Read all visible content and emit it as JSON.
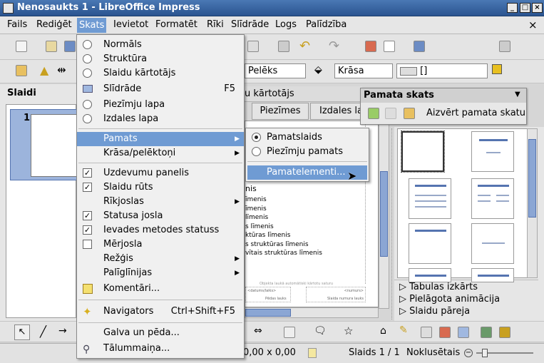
{
  "window": {
    "title": "Nenosaukts 1 - LibreOffice Impress",
    "controls": [
      "_",
      "□",
      "×"
    ],
    "doc_close": "×"
  },
  "menubar": [
    "Fails",
    "Rediģēt",
    "Skats",
    "Ievietot",
    "Formatēt",
    "Rīki",
    "Slīdrāde",
    "Logs",
    "Palīdzība"
  ],
  "formatbar": {
    "color_combo": "Pelēks",
    "fill_type": "Krāsa",
    "fill_value": "[]"
  },
  "slides_panel": {
    "title": "Slaidi",
    "slide_number": "1"
  },
  "tabs": {
    "partial_title": "u kārtotājs",
    "tab_notes": "Piezīmes",
    "tab_handouts": "Izdales la"
  },
  "view_menu": {
    "items": [
      {
        "label": "Normāls",
        "type": "radio",
        "checked": false
      },
      {
        "label": "Struktūra",
        "type": "radio",
        "checked": false
      },
      {
        "label": "Slaidu kārtotājs",
        "type": "radio",
        "checked": false
      },
      {
        "label": "Slīdrāde",
        "type": "icon",
        "shortcut": "F5"
      },
      {
        "label": "Piezīmju lapa",
        "type": "radio",
        "checked": false
      },
      {
        "label": "Izdales lapa",
        "type": "radio",
        "checked": false
      },
      {
        "label": "Pamats",
        "type": "submenu",
        "highlighted": true
      },
      {
        "label": "Krāsa/pelēktoņi",
        "type": "submenu"
      },
      {
        "label": "Uzdevumu panelis",
        "type": "check",
        "checked": true
      },
      {
        "label": "Slaidu rūts",
        "type": "check",
        "checked": true
      },
      {
        "label": "Rīkjoslas",
        "type": "submenu"
      },
      {
        "label": "Statusa josla",
        "type": "check",
        "checked": true
      },
      {
        "label": "Ievades metodes statuss",
        "type": "check",
        "checked": true
      },
      {
        "label": "Mērjosla",
        "type": "check",
        "checked": false
      },
      {
        "label": "Režģis",
        "type": "submenu"
      },
      {
        "label": "Palīglīnijas",
        "type": "submenu"
      },
      {
        "label": "Komentāri...",
        "type": "icon"
      },
      {
        "label": "Navigators",
        "type": "icon",
        "shortcut": "Ctrl+Shift+F5"
      },
      {
        "label": "Galva un pēda...",
        "type": "plain"
      },
      {
        "label": "Tālummaiņa...",
        "type": "icon"
      }
    ]
  },
  "master_submenu": {
    "items": [
      {
        "label": "Pamatslaids",
        "type": "radio",
        "checked": true
      },
      {
        "label": "Piezīmju pamats",
        "type": "radio",
        "checked": false
      },
      {
        "label": "Pamatelementi...",
        "type": "plain",
        "highlighted": true
      }
    ]
  },
  "slide_content": {
    "lines": [
      "nis",
      "īmenis",
      "īmenis",
      "līmenis",
      "s līmenis",
      "ktūras līmenis",
      "s struktūras līmenis",
      "vītais struktūras līmenis"
    ],
    "footer_left": "Objekta laukā automātiski kārtotu saturu",
    "footer_boxes": [
      "<datums/laiks>",
      "Pēdas lauks",
      "Slaida numura lauks",
      "<numurs>"
    ]
  },
  "master_view_toolbar": {
    "title": "Pamata skats",
    "close_label": "Aizvērt pamata skatu"
  },
  "task_panes": [
    "Tabulas izkārts",
    "Pielāgota animācija",
    "Slaidu pāreja"
  ],
  "statusbar": {
    "coords": "0,00 x 0,00",
    "slide": "Slaids 1 / 1",
    "master": "Noklusētais"
  }
}
